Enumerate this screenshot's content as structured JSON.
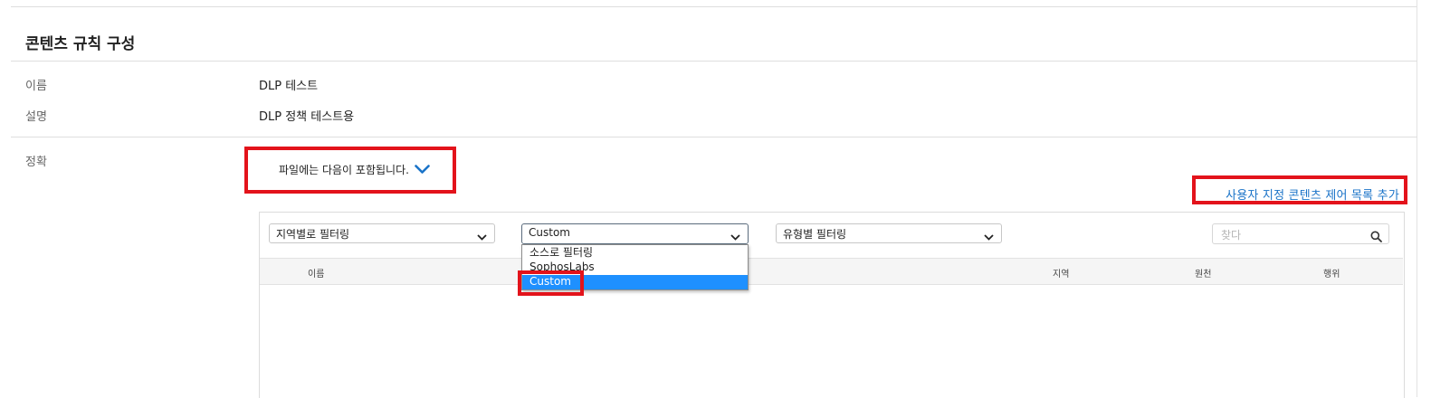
{
  "section": {
    "title": "콘텐츠 규칙 구성"
  },
  "fields": {
    "name_label": "이름",
    "name_value": "DLP 테스트",
    "desc_label": "설명",
    "desc_value": "DLP 정책 테스트용",
    "accuracy_label": "정확"
  },
  "rule": {
    "contains_text": "파일에는 다음이 포함됩니다."
  },
  "add_link": {
    "label": "사용자 지정 콘텐츠 제어 목록 추가"
  },
  "filters": {
    "region_label": "지역별로 필터링",
    "source_selected": "Custom",
    "type_label": "유형별 필터링",
    "search_placeholder": "찾다"
  },
  "source_dropdown": {
    "options": [
      "소스로 필터링",
      "SophosLabs",
      "Custom"
    ],
    "selected_index": 2
  },
  "table": {
    "columns": [
      "이름",
      "지역",
      "원천",
      "행위"
    ]
  },
  "colors": {
    "highlight": "#e3131b",
    "link": "#1a73c8",
    "selected_option": "#1e90ff"
  }
}
